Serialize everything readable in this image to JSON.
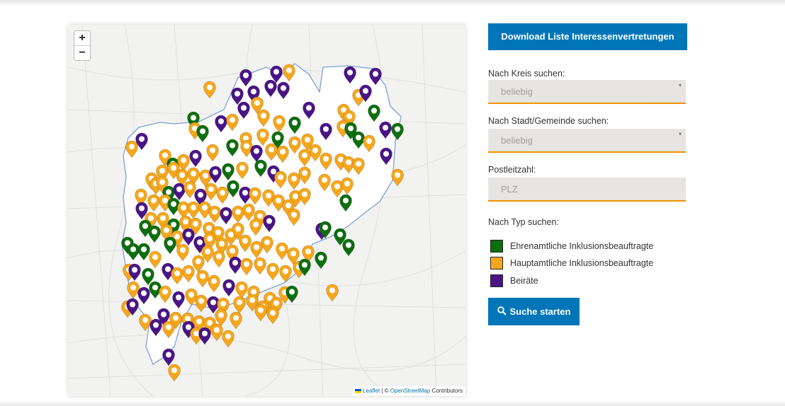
{
  "download_button": {
    "label": "Download Liste Interessenvertretungen"
  },
  "filters": {
    "kreis": {
      "label": "Nach Kreis suchen:",
      "value": "beliebig"
    },
    "stadt": {
      "label": "Nach Stadt/Gemeinde suchen:",
      "value": "beliebig"
    },
    "plz": {
      "label": "Postleitzahl:",
      "placeholder": "PLZ"
    },
    "typ_label": "Nach Typ suchen:"
  },
  "legend": [
    {
      "label": "Ehrenamtliche Inklusionsbeauftragte",
      "color": "#0d6e0d"
    },
    {
      "label": "Hauptamtliche Inklusionsbeauftragte",
      "color": "#f7a71b"
    },
    {
      "label": "Beiräte",
      "color": "#4a1486"
    }
  ],
  "search_button": {
    "label": "Suche starten",
    "icon": "search-icon"
  },
  "map": {
    "zoom_in": "+",
    "zoom_out": "−",
    "attribution": {
      "leaflet": "Leaflet",
      "sep": " | © ",
      "osm": "OpenStreetMap",
      "contrib": " Contributors"
    },
    "marker_types": [
      "ehrenamtlich",
      "hauptamtlich",
      "beirat"
    ]
  }
}
